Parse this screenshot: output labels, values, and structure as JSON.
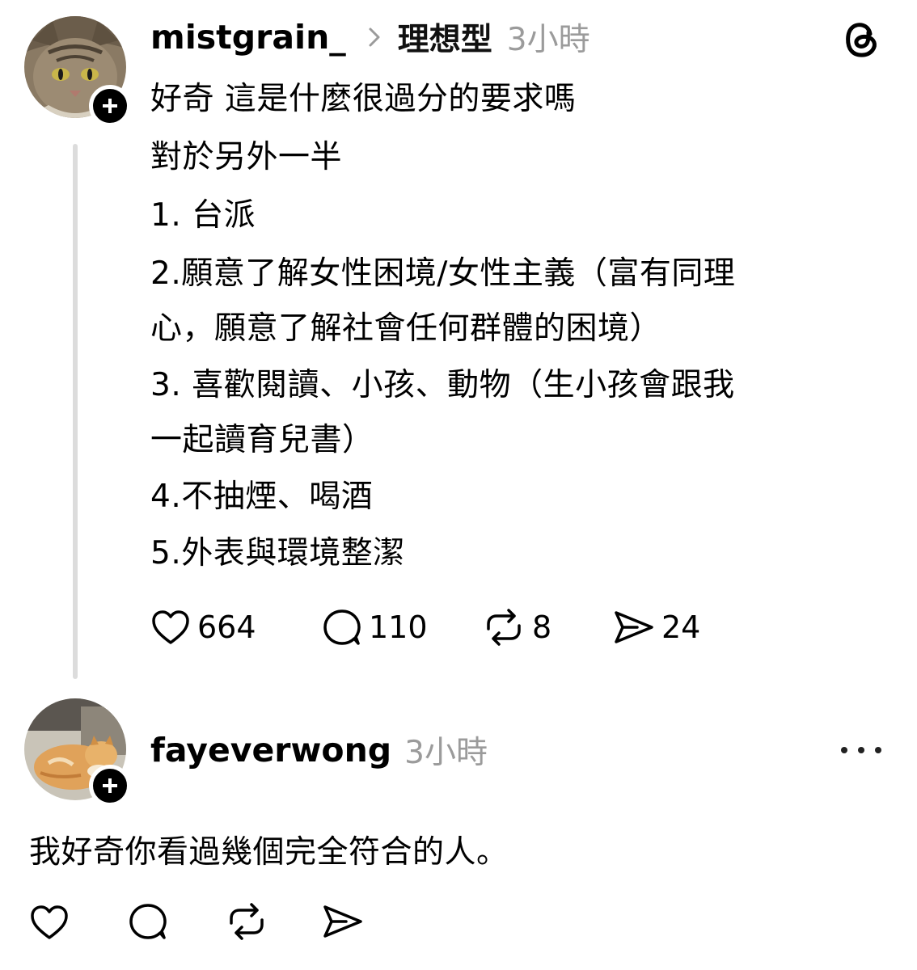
{
  "post": {
    "username": "mistgrain_",
    "topic": "理想型",
    "time": "3小時",
    "lines": [
      "好奇 這是什麼很過分的要求嗎",
      "對於另外一半",
      "1. 台派",
      "2.願意了解女性困境/女性主義（富有同理",
      "心，願意了解社會任何群體的困境）",
      "3. 喜歡閱讀、小孩、動物（生小孩會跟我",
      "一起讀育兒書）",
      "4.不抽煙、喝酒",
      "5.外表與環境整潔"
    ],
    "likes": "664",
    "replies": "110",
    "reposts": "8",
    "shares": "24",
    "icons": [
      "threads-logo-icon",
      "chevron-right-icon",
      "heart-icon",
      "comment-icon",
      "repost-icon",
      "share-icon",
      "plus-icon"
    ]
  },
  "reply": {
    "username": "fayeverwong",
    "time": "3小時",
    "text": "我好奇你看過幾個完全符合的人。",
    "icons": [
      "more-icon",
      "heart-icon",
      "comment-icon",
      "repost-icon",
      "share-icon",
      "plus-icon"
    ]
  },
  "colors": {
    "text": "#000000",
    "muted": "#9b9b9b",
    "thread_line": "#dcdcdc"
  }
}
